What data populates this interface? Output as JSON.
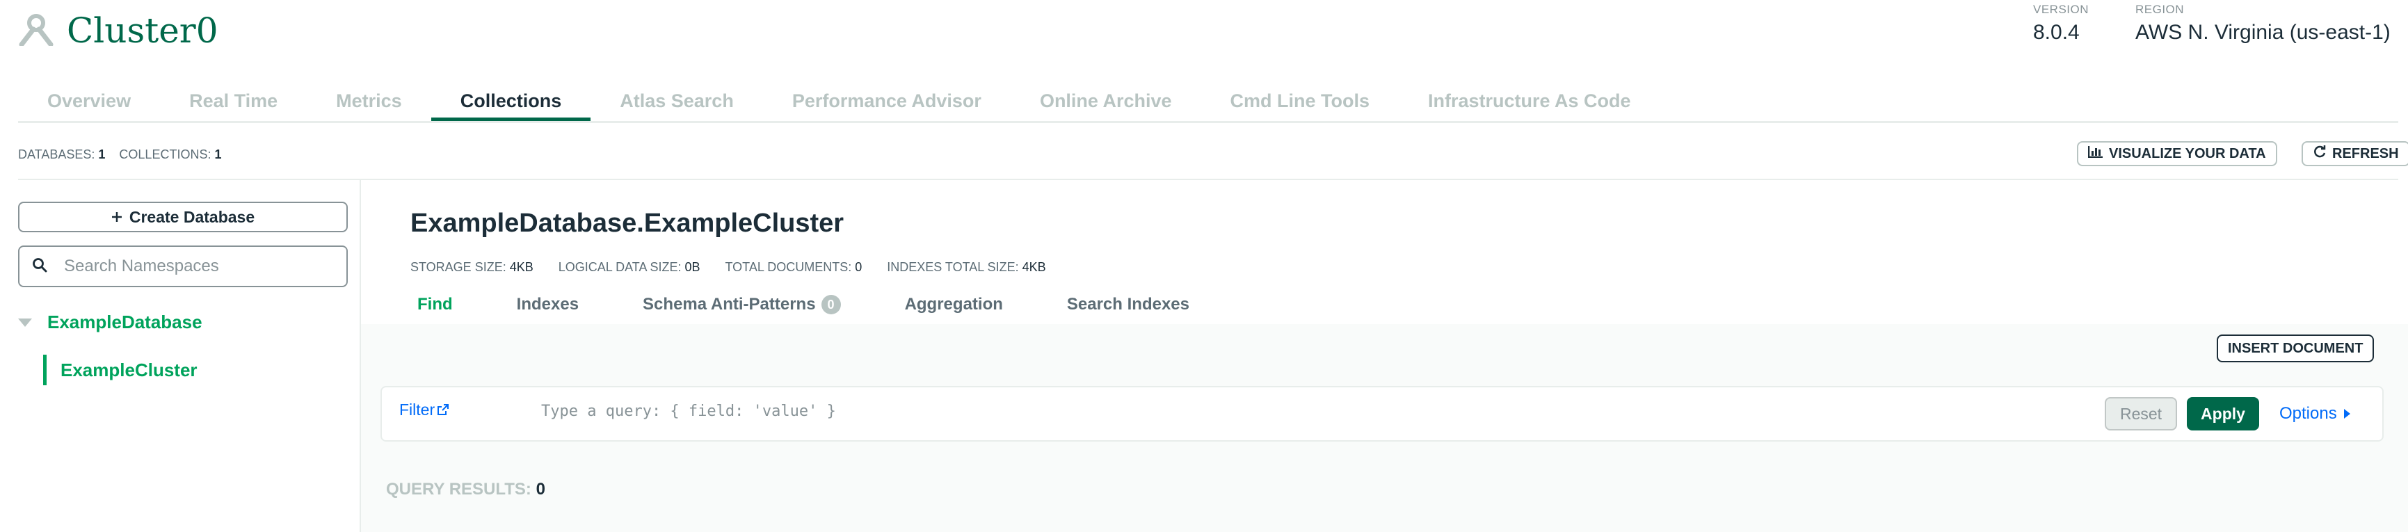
{
  "header": {
    "cluster_name": "Cluster0",
    "version_label": "VERSION",
    "version_value": "8.0.4",
    "region_label": "REGION",
    "region_value": "AWS N. Virginia (us-east-1)"
  },
  "tabs": [
    {
      "label": "Overview",
      "active": false
    },
    {
      "label": "Real Time",
      "active": false
    },
    {
      "label": "Metrics",
      "active": false
    },
    {
      "label": "Collections",
      "active": true
    },
    {
      "label": "Atlas Search",
      "active": false
    },
    {
      "label": "Performance Advisor",
      "active": false
    },
    {
      "label": "Online Archive",
      "active": false
    },
    {
      "label": "Cmd Line Tools",
      "active": false
    },
    {
      "label": "Infrastructure As Code",
      "active": false
    }
  ],
  "stats": {
    "databases_label": "DATABASES:",
    "databases_value": "1",
    "collections_label": "COLLECTIONS:",
    "collections_value": "1"
  },
  "toolbar": {
    "visualize_label": "VISUALIZE YOUR DATA",
    "refresh_label": "REFRESH"
  },
  "sidebar": {
    "create_label": "Create Database",
    "search_placeholder": "Search Namespaces",
    "database": "ExampleDatabase",
    "collection": "ExampleCluster"
  },
  "namespace": {
    "title": "ExampleDatabase.ExampleCluster",
    "storage_label": "STORAGE SIZE:",
    "storage_value": "4KB",
    "logical_label": "LOGICAL DATA SIZE:",
    "logical_value": "0B",
    "docs_label": "TOTAL DOCUMENTS:",
    "docs_value": "0",
    "indexes_label": "INDEXES TOTAL SIZE:",
    "indexes_value": "4KB"
  },
  "subtabs": {
    "find": "Find",
    "indexes": "Indexes",
    "schema": "Schema Anti-Patterns",
    "schema_count": "0",
    "aggregation": "Aggregation",
    "search_indexes": "Search Indexes"
  },
  "query": {
    "insert_label": "INSERT DOCUMENT",
    "filter_label": "Filter",
    "placeholder": "Type a query: { field: 'value' }",
    "reset_label": "Reset",
    "apply_label": "Apply",
    "options_label": "Options",
    "results_label": "QUERY RESULTS:",
    "results_count": "0"
  },
  "colors": {
    "brand_green": "#00684a",
    "accent_green": "#00a35c",
    "link_blue": "#016bf8"
  }
}
